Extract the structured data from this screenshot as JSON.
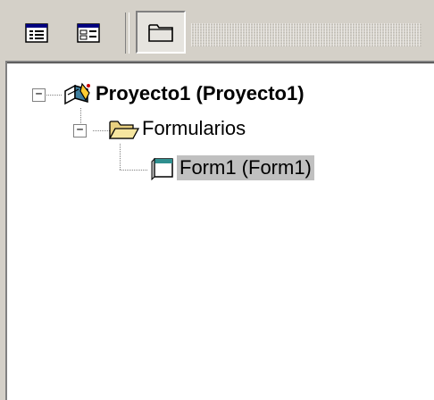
{
  "toolbar": {
    "buttons": [
      {
        "icon": "view-code-icon"
      },
      {
        "icon": "view-object-icon"
      },
      {
        "icon": "toggle-folders-icon"
      }
    ]
  },
  "tree": {
    "project": {
      "label": "Proyecto1 (Proyecto1)",
      "expander": "−",
      "icon": "project-icon"
    },
    "folder": {
      "label": "Formularios",
      "expander": "−",
      "icon": "open-folder-icon"
    },
    "form": {
      "label": "Form1 (Form1)",
      "icon": "form-icon",
      "selected": true
    }
  },
  "colors": {
    "background": "#d4d0c8",
    "panel": "#ffffff",
    "selection": "#c0c0c0"
  }
}
